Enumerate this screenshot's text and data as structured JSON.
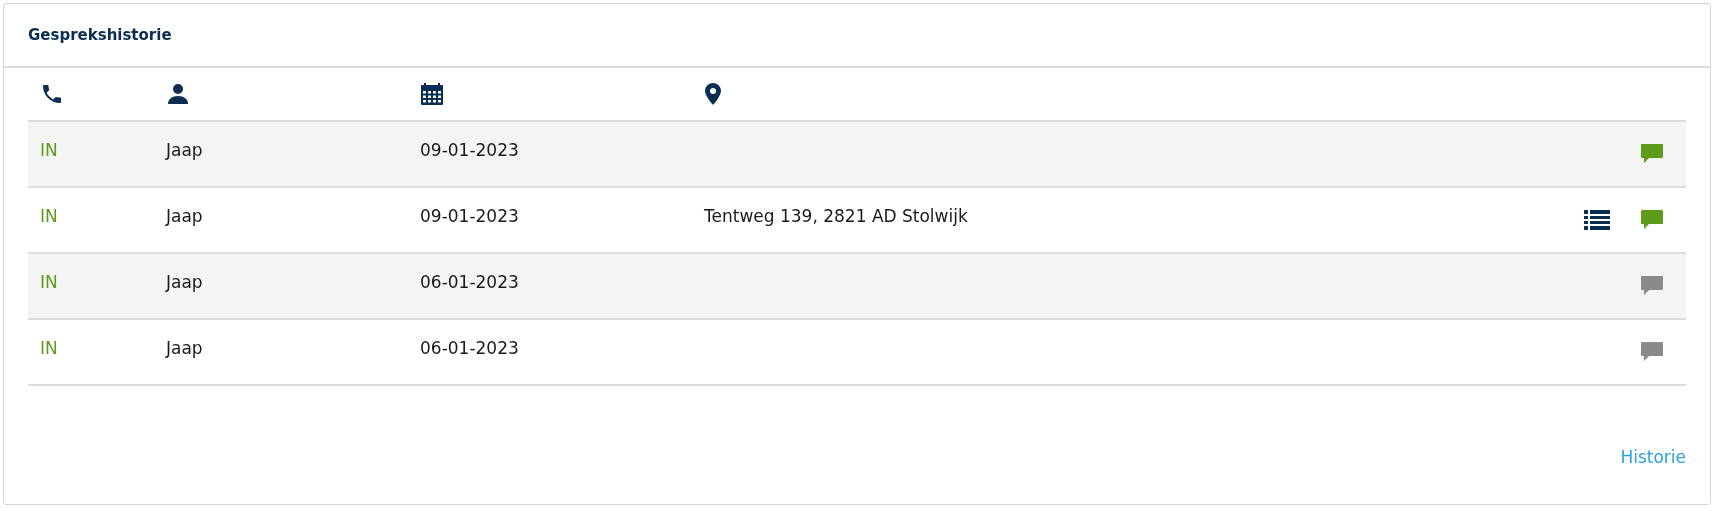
{
  "panel": {
    "title": "Gesprekshistorie"
  },
  "rows": [
    {
      "direction": "IN",
      "name": "Jaap",
      "date": "09-01-2023",
      "has_details": false,
      "has_notes": true
    },
    {
      "direction": "IN",
      "name": "Jaap",
      "date": "09-01-2023",
      "location": "Tentweg 139, 2821 AD Stolwijk",
      "has_details": true,
      "has_notes": true
    },
    {
      "direction": "IN",
      "name": "Jaap",
      "date": "06-01-2023",
      "has_details": false,
      "has_notes": false
    },
    {
      "direction": "IN",
      "name": "Jaap",
      "date": "06-01-2023",
      "has_details": false,
      "has_notes": false
    }
  ],
  "footer_link": "Historie"
}
